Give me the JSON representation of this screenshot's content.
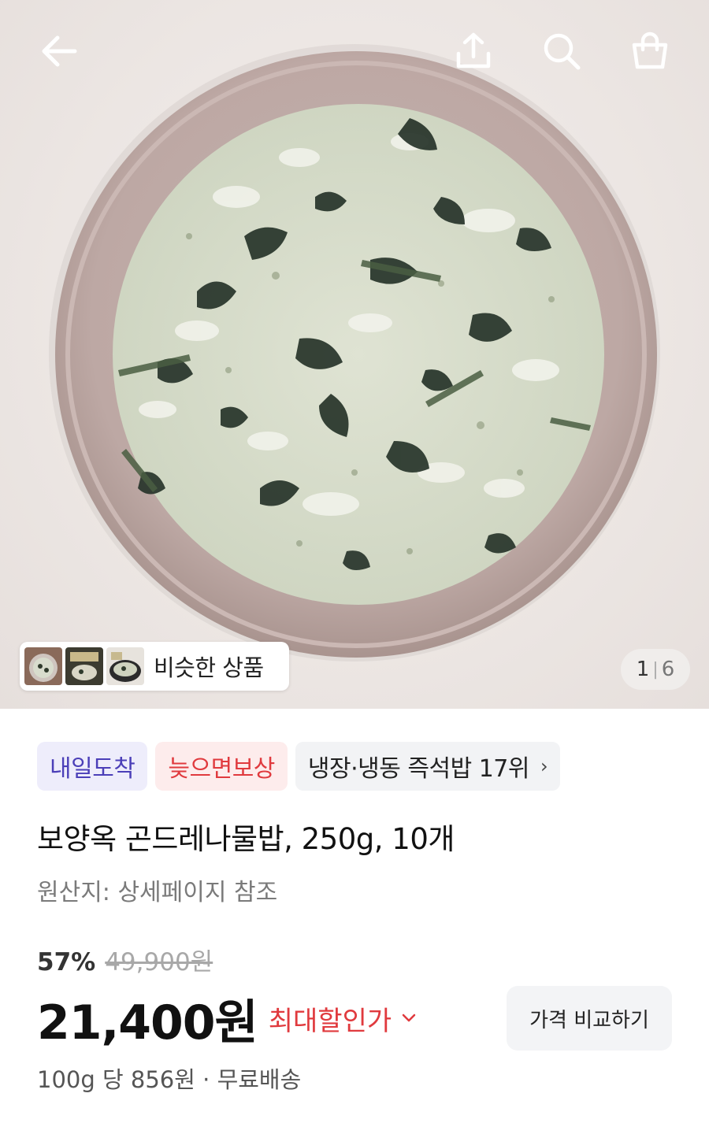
{
  "header": {
    "back_icon": "back-arrow-icon",
    "share_icon": "share-icon",
    "search_icon": "search-icon",
    "cart_icon": "shopping-bag-icon"
  },
  "gallery": {
    "similar_label": "비슷한 상품",
    "page_current": "1",
    "page_separator": "|",
    "page_total": "6"
  },
  "badges": {
    "tomorrow": "내일도착",
    "late_comp": "늦으면보상",
    "ranking": "냉장·냉동 즉석밥 17위",
    "ranking_chevron": "›"
  },
  "product": {
    "title": "보양옥 곤드레나물밥, 250g, 10개",
    "origin": "원산지: 상세페이지 참조"
  },
  "pricing": {
    "discount_rate": "57%",
    "original_price": "49,900원",
    "sale_price": "21,400원",
    "max_discount_label": "최대할인가",
    "compare_button": "가격 비교하기",
    "unit_price": "100g 당 856원 · 무료배송"
  },
  "colors": {
    "accent_red": "#e03a3e",
    "badge_purple": "#4b3fb8",
    "badge_purple_bg": "#eeedfb",
    "badge_red_bg": "#fdecec",
    "badge_gray_bg": "#f2f3f5"
  }
}
